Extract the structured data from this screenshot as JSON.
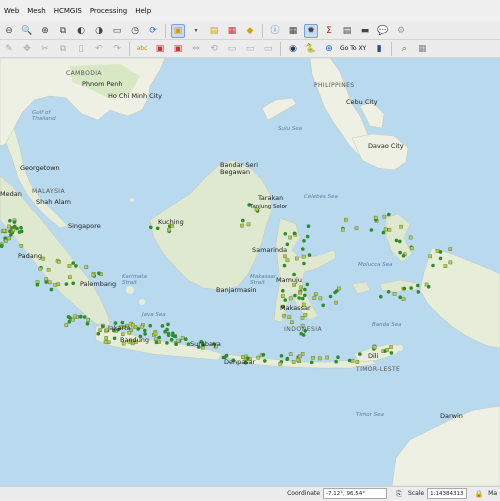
{
  "menubar": [
    "Web",
    "Mesh",
    "HCMGIS",
    "Processing",
    "Help"
  ],
  "toolbar": {
    "goto_label": "Go To XY"
  },
  "labels": {
    "cambodia": "CAMBODIA",
    "phnom_penh": "Phnom Penh",
    "ho_chi_minh": "Ho Chi Minh City",
    "gulf_thailand": "Gulf of Thailand",
    "philippines": "PHILIPPINES",
    "cebu": "Cebu City",
    "davao": "Davao City",
    "sulu_sea": "Sulu Sea",
    "celebes_sea": "Celebes Sea",
    "georgetown": "Georgetown",
    "medan": "Medan",
    "malaysia": "MALAYSIA",
    "shah_alam": "Shah Alam",
    "singapore": "Singapore",
    "bandar": "Bandar Seri Begawan",
    "tarakan": "Tarakan",
    "tanjung": "Tanjung Selor",
    "kuching": "Kuching",
    "samarinda": "Samarinda",
    "makassar_strait": "Makassar Strait",
    "mamuju": "Mamuju",
    "makassar": "Makassar",
    "indonesia": "INDONESIA",
    "molucca_sea": "Molucca Sea",
    "banda_sea": "Banda Sea",
    "karimata": "Karimata Strait",
    "padang": "Padang",
    "palembang": "Palembang",
    "java_sea": "Java Sea",
    "banjarmasin": "Banjarmasin",
    "jakarta": "Jakarta",
    "bandung": "Bandung",
    "surabaya": "Surabaya",
    "denpasar": "Denpasar",
    "dili": "Dili",
    "timor_leste": "TIMOR-LESTE",
    "timor_sea": "Timor Sea",
    "darwin": "Darwin"
  },
  "status": {
    "coordinate_label": "Coordinate",
    "coordinate_value": "-7.12°, 96.54°",
    "scale_label": "Scale",
    "scale_value": "1:14384313",
    "right_label": "Ma"
  },
  "colors": {
    "point_dark": "#2e8b2e",
    "point_light": "#a6d24a",
    "point_outline": "#666633"
  }
}
